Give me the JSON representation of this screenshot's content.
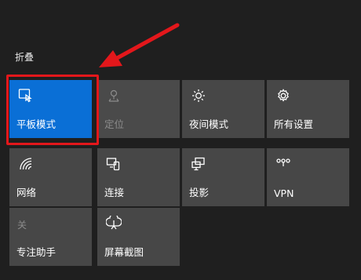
{
  "header": {
    "collapse_label": "折叠"
  },
  "tiles": [
    {
      "label": "平板模式",
      "icon": "tablet-mode-icon",
      "state": "on"
    },
    {
      "label": "定位",
      "icon": "location-icon",
      "state": "disabled"
    },
    {
      "label": "夜间模式",
      "icon": "brightness-icon",
      "state": "off"
    },
    {
      "label": "所有设置",
      "icon": "gear-icon",
      "state": "off"
    },
    {
      "label": "网络",
      "icon": "wifi-icon",
      "state": "off"
    },
    {
      "label": "连接",
      "icon": "connect-icon",
      "state": "off"
    },
    {
      "label": "投影",
      "icon": "project-icon",
      "state": "off"
    },
    {
      "label": "VPN",
      "icon": "vpn-icon",
      "state": "off"
    },
    {
      "label": "专注助手",
      "icon": "moon-icon",
      "state": "off"
    },
    {
      "label": "屏幕截图",
      "icon": "snip-icon",
      "state": "off"
    }
  ],
  "colors": {
    "active": "#0a6fd6",
    "tile": "#474747",
    "background": "#1f1f1f",
    "annotation": "#e3171b"
  },
  "focus_assist_status": "关"
}
